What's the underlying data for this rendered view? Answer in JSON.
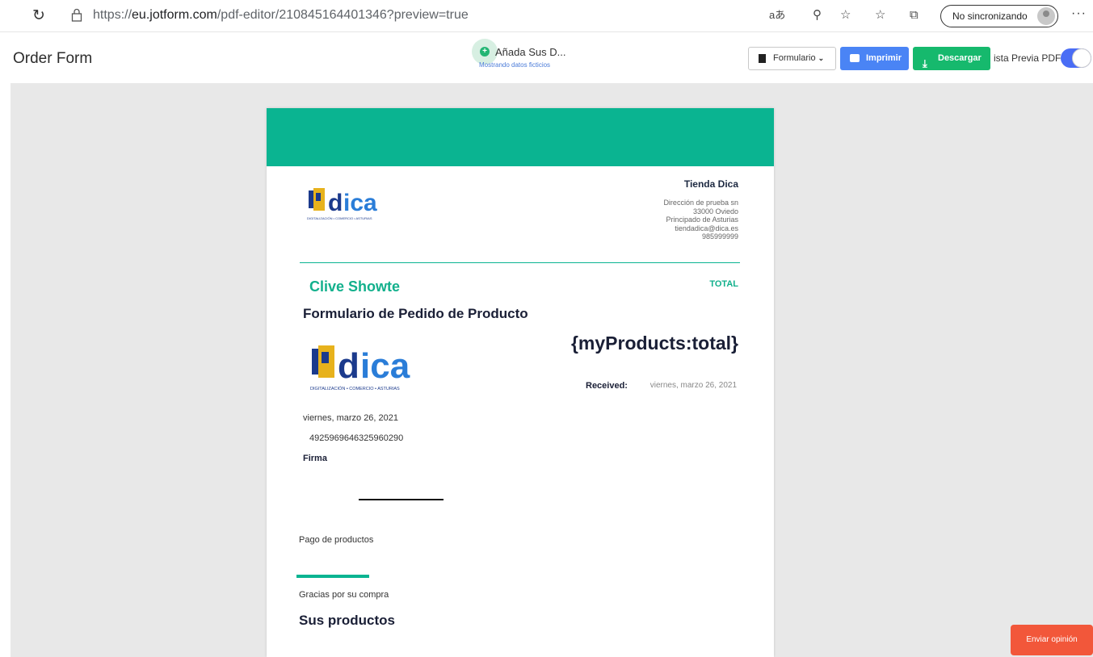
{
  "browser": {
    "url_prefix": "https://",
    "url_host": "eu.jotform.com",
    "url_path": "/pdf-editor/210845164401346?preview=true",
    "sync_label": "No sincronizando"
  },
  "header": {
    "title": "Order Form",
    "add_data_label": "Añada Sus D...",
    "add_data_sub": "Mostrando datos ficticios",
    "form_button": "Formulario",
    "print_button": "Imprimir",
    "download_button": "Descargar",
    "preview_label": "ista Previa PDF",
    "preview_enabled": true
  },
  "document": {
    "store_name": "Tienda Dica",
    "store_lines": [
      "Dirección de prueba sn",
      "33000 Oviedo",
      "Principado de Asturias",
      "tiendadica@dica.es",
      "985999999"
    ],
    "logo_tagline": "DIGITALIZACIÓN • COMERCIO • ASTURIAS",
    "customer_name": "Clive Showte",
    "total_label": "TOTAL",
    "form_title": "Formulario de Pedido de Producto",
    "total_value": "{myProducts:total}",
    "received_label": "Received:",
    "received_value": "viernes, marzo 26, 2021",
    "date": "viernes, marzo 26, 2021",
    "id_number": "4925969646325960290",
    "signature_label": "Firma",
    "payment_label": "Pago de productos",
    "thanks": "Gracias por su compra",
    "products_heading": "Sus productos"
  },
  "feedback_button": "Enviar opinión",
  "colors": {
    "accent": "#0ab491",
    "print": "#4a84f5",
    "download": "#16b96d",
    "feedback": "#f2573a"
  }
}
